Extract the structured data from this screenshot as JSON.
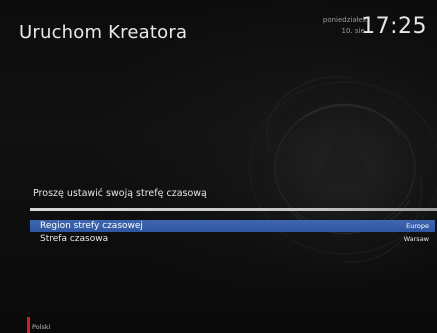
{
  "header": {
    "title": "Uruchom Kreatora",
    "day": "poniedziałek",
    "date": "10. sie.",
    "time": "17:25"
  },
  "main": {
    "prompt": "Proszę ustawić swoją strefę czasową",
    "rows": [
      {
        "label": "Region strefy czasowej",
        "value": "Europe",
        "selected": true
      },
      {
        "label": "Strefa czasowa",
        "value": "Warsaw",
        "selected": false
      }
    ]
  },
  "footer": {
    "language": "Polski"
  },
  "colors": {
    "selection": "#3560a8",
    "language_marker": "#d01c24"
  }
}
